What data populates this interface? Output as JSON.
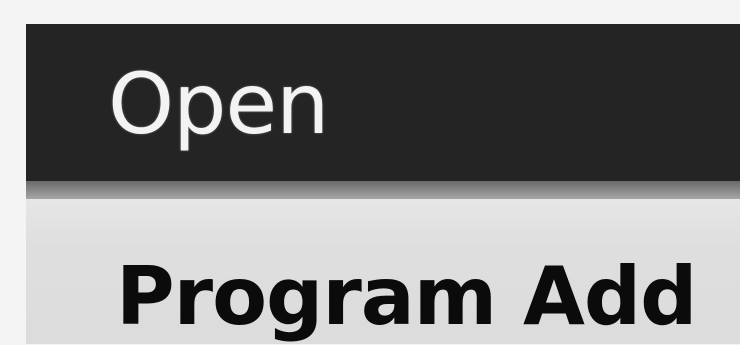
{
  "menu": {
    "items": [
      {
        "label": "Open",
        "state": "highlighted"
      },
      {
        "label": "Program Add",
        "state": "normal"
      }
    ]
  },
  "colors": {
    "highlight_bg": "#242424",
    "highlight_text": "#f3f3f3",
    "item_bg": "#dedede",
    "item_text": "#0b0b0b"
  }
}
